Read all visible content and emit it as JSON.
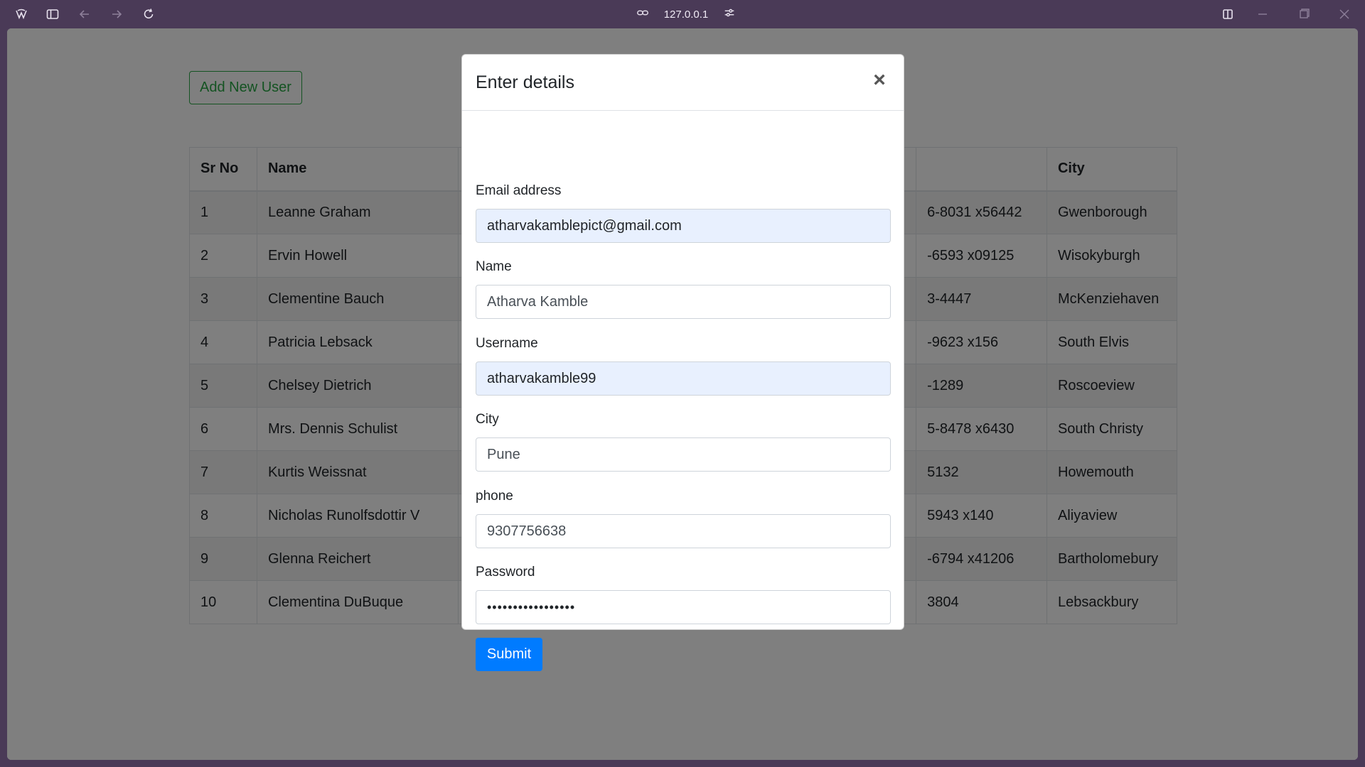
{
  "browser": {
    "url": "127.0.0.1",
    "icons": [
      "browser-logo-icon",
      "sidebar-toggle-icon",
      "back-arrow-icon",
      "forward-arrow-icon",
      "reload-icon",
      "link-icon",
      "site-settings-icon",
      "split-view-icon",
      "minimize-icon",
      "maximize-icon",
      "close-window-icon"
    ]
  },
  "page": {
    "add_button": "Add New User"
  },
  "table": {
    "headers": [
      "Sr No",
      "Name",
      "",
      "",
      "",
      "City"
    ],
    "rows": [
      {
        "sr": "1",
        "name": "Leanne Graham",
        "phone": "6-8031 x56442",
        "city": "Gwenborough"
      },
      {
        "sr": "2",
        "name": "Ervin Howell",
        "phone": "-6593 x09125",
        "city": "Wisokyburgh"
      },
      {
        "sr": "3",
        "name": "Clementine Bauch",
        "phone": "3-4447",
        "city": "McKenziehaven"
      },
      {
        "sr": "4",
        "name": "Patricia Lebsack",
        "phone": "-9623 x156",
        "city": "South Elvis"
      },
      {
        "sr": "5",
        "name": "Chelsey Dietrich",
        "phone": "-1289",
        "city": "Roscoeview"
      },
      {
        "sr": "6",
        "name": "Mrs. Dennis Schulist",
        "phone": "5-8478 x6430",
        "city": "South Christy"
      },
      {
        "sr": "7",
        "name": "Kurtis Weissnat",
        "phone": "5132",
        "city": "Howemouth"
      },
      {
        "sr": "8",
        "name": "Nicholas Runolfsdottir V",
        "phone": "5943 x140",
        "city": "Aliyaview"
      },
      {
        "sr": "9",
        "name": "Glenna Reichert",
        "phone": "-6794 x41206",
        "city": "Bartholomebury"
      },
      {
        "sr": "10",
        "name": "Clementina DuBuque",
        "phone": "3804",
        "city": "Lebsackbury"
      }
    ]
  },
  "modal": {
    "title": "Enter details",
    "close_symbol": "×",
    "fields": {
      "email": {
        "label": "Email address",
        "value": "atharvakamblepict@gmail.com"
      },
      "name": {
        "label": "Name",
        "value": "Atharva Kamble"
      },
      "username": {
        "label": "Username",
        "value": "atharvakamble99"
      },
      "city": {
        "label": "City",
        "value": "Pune"
      },
      "phone": {
        "label": "phone",
        "value": "9307756638"
      },
      "password": {
        "label": "Password",
        "value": "•••••••••••••••••"
      }
    },
    "submit": "Submit"
  },
  "colors": {
    "chrome": "#4a3a57",
    "success": "#28a745",
    "primary": "#007bff",
    "autofill": "#e8f0fe"
  }
}
